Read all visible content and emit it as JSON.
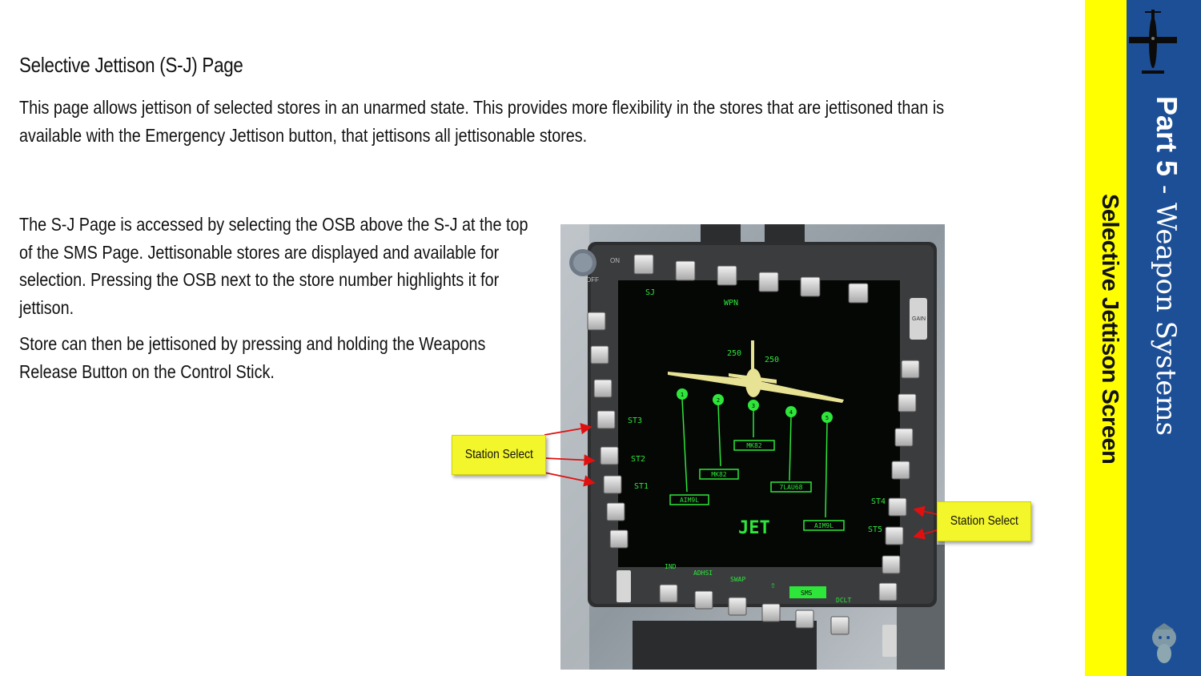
{
  "heading": "Selective Jettison (S-J) Page",
  "paragraphs": {
    "intro": "This page allows jettison of selected stores in an unarmed state. This provides more flexibility in the stores that are jettisoned than is available with the Emergency Jettison button, that jettisons all jettisonable stores.",
    "access": "The S-J Page is accessed by selecting the OSB above the S-J at the top of the SMS Page. Jettisonable stores are displayed and available for selection. Pressing the OSB next to the store number highlights it for jettison.",
    "release": "Store can then be jettisoned by pressing and holding the Weapons Release Button on the Control Stick."
  },
  "callouts": {
    "left": "Station Select",
    "right": "Station Select"
  },
  "sidebar": {
    "part": "Part 5",
    "separator": " - ",
    "section": "Weapon Systems",
    "subtitle": "Selective Jettison Screen"
  },
  "mfd": {
    "top_left": "SJ",
    "top_center": "WPN",
    "left_labels": [
      "ST3",
      "ST2",
      "ST1"
    ],
    "right_labels": [
      "ST4",
      "ST5"
    ],
    "bottom_labels": [
      "IND",
      "ADHSI",
      "SWAP",
      "⇧",
      "SMS",
      "DCLT"
    ],
    "speed_left": "250",
    "speed_right": "250",
    "station_numbers": [
      "1",
      "2",
      "3",
      "4",
      "5"
    ],
    "stores": [
      "AIM9L",
      "MK82",
      "MK82",
      "7LAU68",
      "AIM9L"
    ],
    "status": "JET",
    "knob_labels": [
      "ON",
      "OFF"
    ],
    "gain_label": "GAIN"
  },
  "colors": {
    "symbology": "#2ee63a",
    "aircraft": "#e8e294",
    "yellow": "#ffff00",
    "blue": "#1d4f96"
  }
}
